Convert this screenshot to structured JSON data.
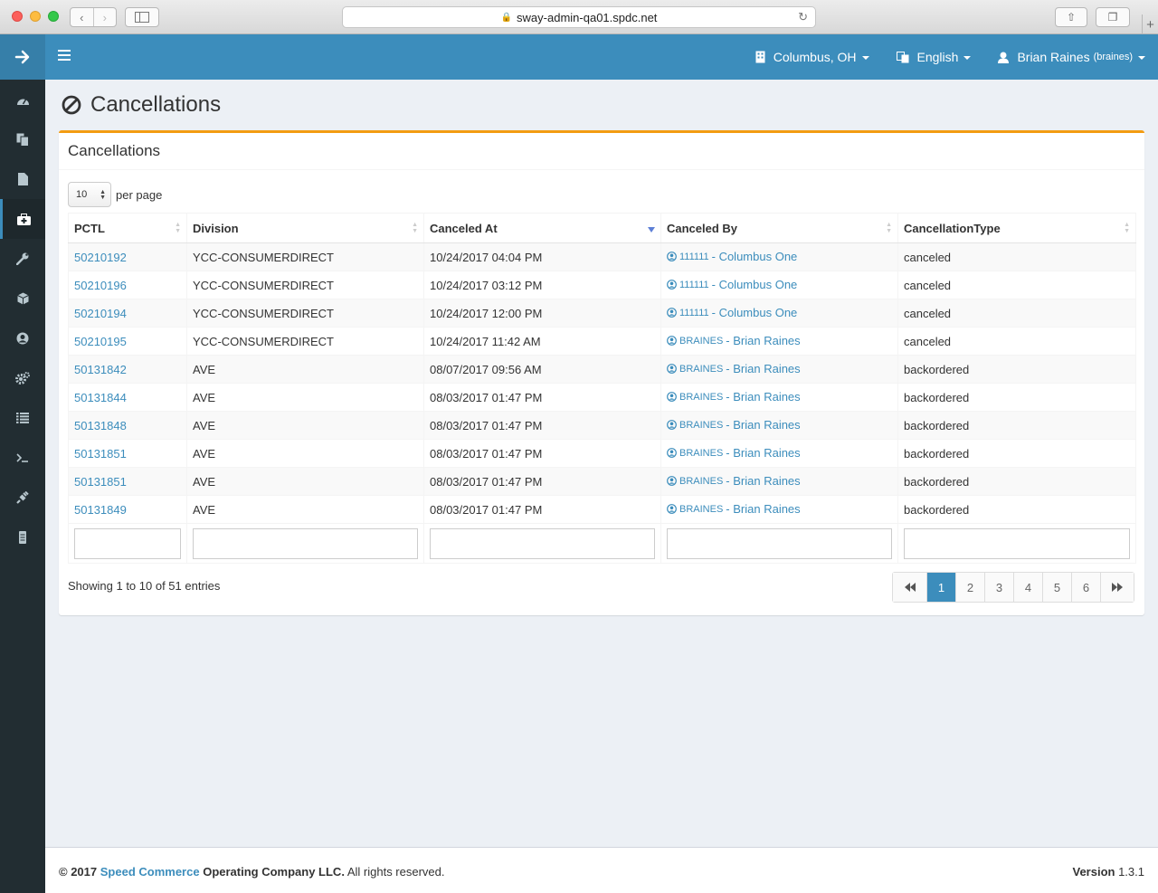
{
  "browser": {
    "url": "sway-admin-qa01.spdc.net"
  },
  "header": {
    "location": "Columbus, OH",
    "language": "English",
    "user_name": "Brian Raines",
    "user_login": "(braines)"
  },
  "sidebar": {
    "items": [
      {
        "icon": "dashboard-icon"
      },
      {
        "icon": "copy-icon"
      },
      {
        "icon": "file-icon"
      },
      {
        "icon": "medkit-icon",
        "active": true
      },
      {
        "icon": "wrench-icon"
      },
      {
        "icon": "cube-icon"
      },
      {
        "icon": "user-circle-icon"
      },
      {
        "icon": "cogs-icon"
      },
      {
        "icon": "list-icon"
      },
      {
        "icon": "terminal-icon"
      },
      {
        "icon": "plug-icon"
      },
      {
        "icon": "server-icon"
      }
    ]
  },
  "page": {
    "title": "Cancellations",
    "box_title": "Cancellations",
    "per_page_value": "10",
    "per_page_label": "per page",
    "showing_text": "Showing 1 to 10 of 51 entries"
  },
  "table": {
    "columns": [
      "PCTL",
      "Division",
      "Canceled At",
      "Canceled By",
      "CancellationType"
    ],
    "rows": [
      {
        "pctl": "50210192",
        "division": "YCC-CONSUMERDIRECT",
        "canceled_at": "10/24/2017 04:04 PM",
        "by_code": "111111",
        "by_name": "- Columbus One",
        "type": "canceled"
      },
      {
        "pctl": "50210196",
        "division": "YCC-CONSUMERDIRECT",
        "canceled_at": "10/24/2017 03:12 PM",
        "by_code": "111111",
        "by_name": "- Columbus One",
        "type": "canceled"
      },
      {
        "pctl": "50210194",
        "division": "YCC-CONSUMERDIRECT",
        "canceled_at": "10/24/2017 12:00 PM",
        "by_code": "111111",
        "by_name": "- Columbus One",
        "type": "canceled"
      },
      {
        "pctl": "50210195",
        "division": "YCC-CONSUMERDIRECT",
        "canceled_at": "10/24/2017 11:42 AM",
        "by_code": "BRAINES",
        "by_name": "- Brian Raines",
        "type": "canceled"
      },
      {
        "pctl": "50131842",
        "division": "AVE",
        "canceled_at": "08/07/2017 09:56 AM",
        "by_code": "BRAINES",
        "by_name": "- Brian Raines",
        "type": "backordered"
      },
      {
        "pctl": "50131844",
        "division": "AVE",
        "canceled_at": "08/03/2017 01:47 PM",
        "by_code": "BRAINES",
        "by_name": "- Brian Raines",
        "type": "backordered"
      },
      {
        "pctl": "50131848",
        "division": "AVE",
        "canceled_at": "08/03/2017 01:47 PM",
        "by_code": "BRAINES",
        "by_name": "- Brian Raines",
        "type": "backordered"
      },
      {
        "pctl": "50131851",
        "division": "AVE",
        "canceled_at": "08/03/2017 01:47 PM",
        "by_code": "BRAINES",
        "by_name": "- Brian Raines",
        "type": "backordered"
      },
      {
        "pctl": "50131851",
        "division": "AVE",
        "canceled_at": "08/03/2017 01:47 PM",
        "by_code": "BRAINES",
        "by_name": "- Brian Raines",
        "type": "backordered"
      },
      {
        "pctl": "50131849",
        "division": "AVE",
        "canceled_at": "08/03/2017 01:47 PM",
        "by_code": "BRAINES",
        "by_name": "- Brian Raines",
        "type": "backordered"
      }
    ]
  },
  "pagination": {
    "pages": [
      "1",
      "2",
      "3",
      "4",
      "5",
      "6"
    ],
    "current": "1"
  },
  "footer": {
    "copyright_prefix": "© 2017",
    "company_link": "Speed Commerce",
    "company_rest": "Operating Company LLC.",
    "rights": "All rights reserved.",
    "version_label": "Version",
    "version_value": "1.3.1"
  },
  "colors": {
    "primary": "#3c8dbc",
    "sidebar": "#222d32",
    "box_accent": "#f39c12"
  }
}
